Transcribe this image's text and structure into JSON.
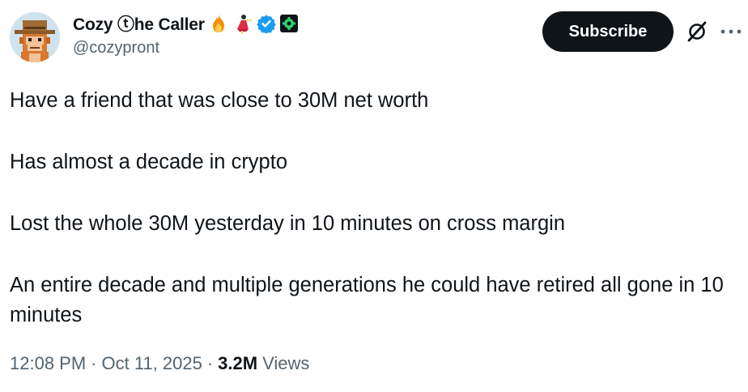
{
  "author": {
    "display_name": "Cozy ⓣhe Caller",
    "handle": "@cozypront",
    "badges": [
      "fire-emoji",
      "dancer-emoji",
      "verified-badge",
      "green-gear-badge"
    ],
    "avatar": "pixel-art-monkey-cowboy-hat-avatar"
  },
  "header": {
    "subscribe_label": "Subscribe",
    "icons": [
      "grok-icon",
      "more-icon"
    ]
  },
  "tweet": {
    "paragraphs": [
      "Have a friend that was close to 30M net worth",
      "Has almost a decade in crypto",
      "Lost the whole 30M yesterday in 10 minutes on cross margin",
      "An entire decade and multiple generations he could have retired all gone in 10 minutes"
    ]
  },
  "meta": {
    "time": "12:08 PM",
    "date": "Oct 11, 2025",
    "separator": "·",
    "views_count": "3.2M",
    "views_label": "Views"
  },
  "colors": {
    "text": "#0f1419",
    "secondary": "#536471",
    "button_bg": "#0f1419",
    "verified": "#1d9bf0"
  }
}
